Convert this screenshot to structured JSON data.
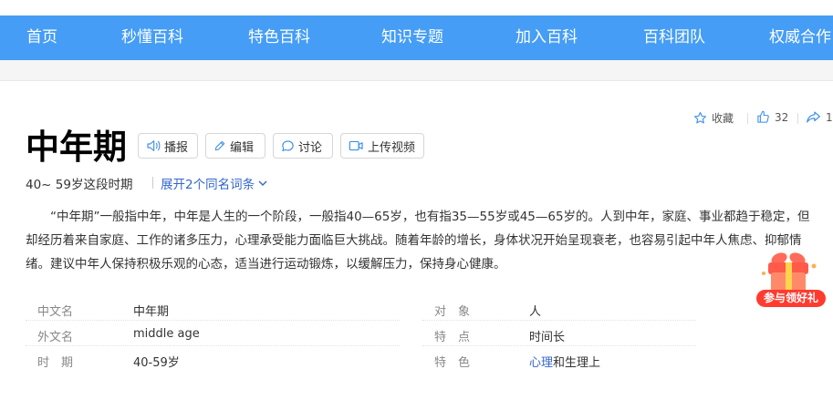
{
  "nav": [
    "首页",
    "秒懂百科",
    "特色百科",
    "知识专题",
    "加入百科",
    "百科团队",
    "权威合作"
  ],
  "actions": {
    "collect": "收藏",
    "like_count": "32",
    "share_count": "1"
  },
  "title": "中年期",
  "buttons": {
    "play": "播报",
    "edit": "编辑",
    "discuss": "讨论",
    "upload": "上传视频"
  },
  "subtitle": "40~ 59岁这段时期",
  "expand": "展开2个同名词条",
  "summary": "“中年期”一般指中年，中年是人生的一个阶段，一般指40—65岁，也有指35—55岁或45—65岁的。人到中年，家庭、事业都趋于稳定，但却经历着来自家庭、工作的诸多压力，心理承受能力面临巨大挑战。随着年龄的增长，身体状况开始呈现衰老，也容易引起中年人焦虑、抑郁情绪。建议中年人保持积极乐观的心态，适当进行运动锻炼，以缓解压力，保持身心健康。",
  "gift_label": "参与领好礼",
  "info": [
    {
      "k1": "中文名",
      "v1": "中年期",
      "k2": "对　象",
      "v2": "人"
    },
    {
      "k1": "外文名",
      "v1": "middle age",
      "k2": "特　点",
      "v2": "时间长"
    },
    {
      "k1": "时　期",
      "v1": "40-59岁",
      "k2": "特　色",
      "v2_link": "心理",
      "v2": "和生理上"
    }
  ]
}
